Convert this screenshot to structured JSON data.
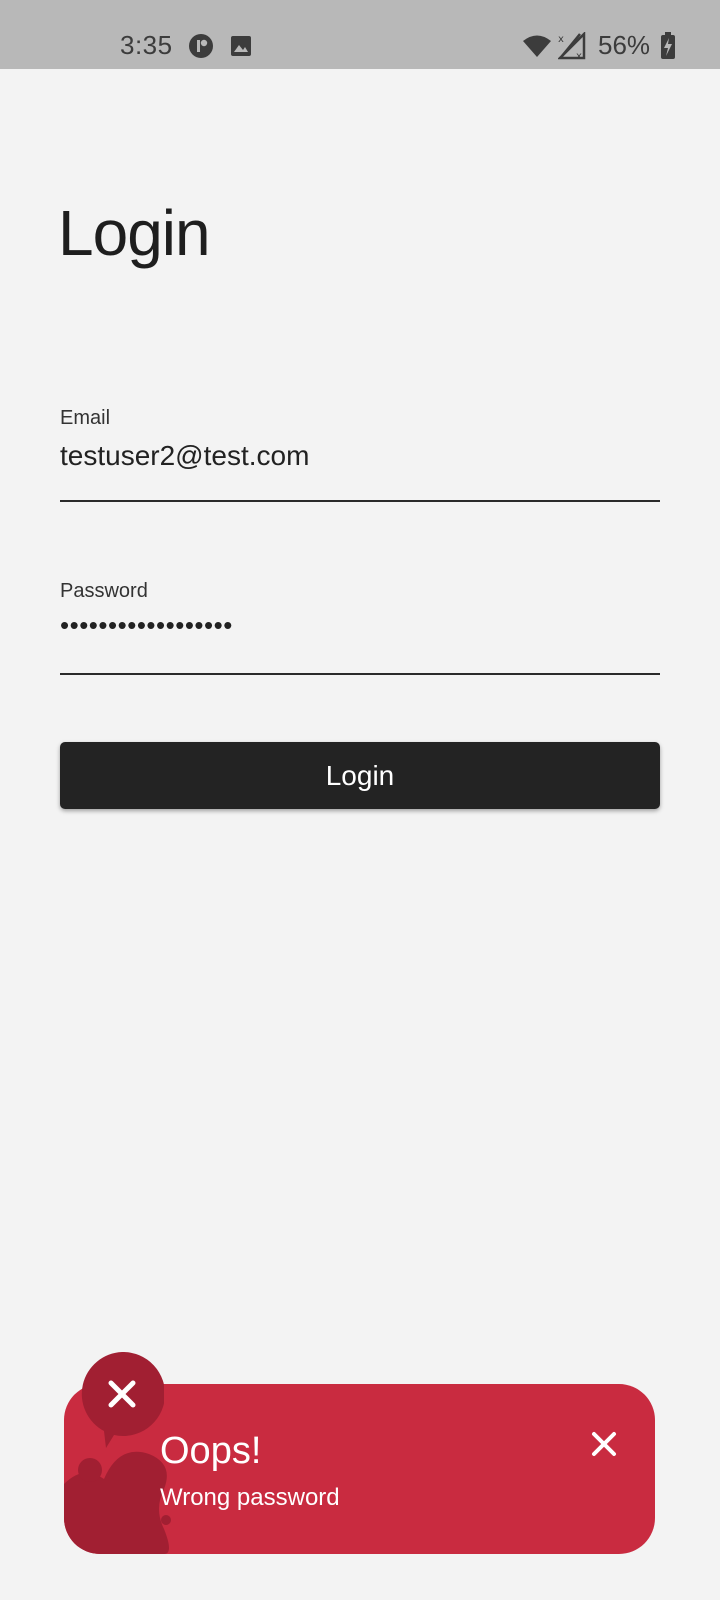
{
  "status_bar": {
    "time": "3:35",
    "battery": "56%",
    "icons": [
      "app-notification-icon",
      "image-icon",
      "wifi-icon",
      "no-signal-icon",
      "battery-charging-icon"
    ]
  },
  "login": {
    "title": "Login",
    "email_label": "Email",
    "email_value": "testuser2@test.com",
    "password_label": "Password",
    "password_value": "••••••••••••••••••",
    "button_label": "Login"
  },
  "toast": {
    "title": "Oops!",
    "message": "Wrong password",
    "background_color": "#c92b40",
    "accent_color": "#a11f32",
    "icons": [
      "error-x-icon",
      "close-icon"
    ]
  },
  "colors": {
    "background": "#f3f3f3",
    "status_bar": "#b8b8b8",
    "button": "#232323"
  }
}
